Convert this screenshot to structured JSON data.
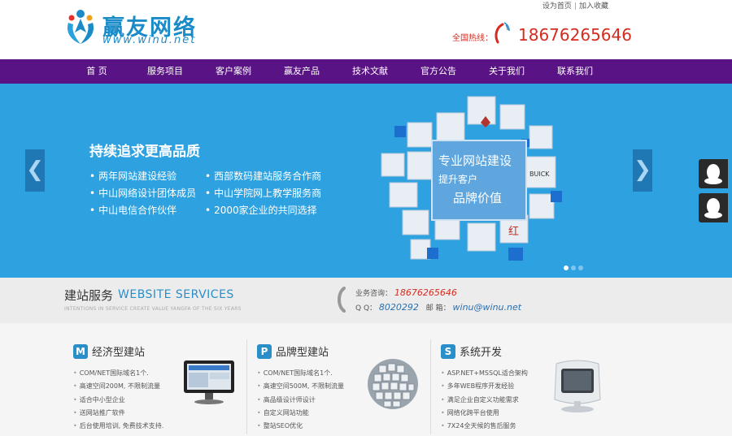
{
  "header": {
    "logo_title": "赢友网络",
    "logo_url": "www.winu.net",
    "top_links": [
      "设为首页",
      "加入收藏"
    ],
    "top_sep": "|",
    "hotline_label": "全国热线：",
    "hotline_number": "18676265646"
  },
  "nav": {
    "items": [
      "首  页",
      "服务项目",
      "客户案例",
      "赢友产品",
      "技术文献",
      "官方公告",
      "关于我们",
      "联系我们"
    ]
  },
  "banner": {
    "title": "持续追求更高品质",
    "bullets": [
      "两年网站建设经验",
      "西部数码建站服务合作商",
      "中山网络设计团体成员",
      "中山学院网上教学服务商",
      "中山电信合作伙伴",
      "2000家企业的共同选择"
    ],
    "prev": "❮",
    "next": "❯",
    "art_line1": "专业网站建设",
    "art_line2": "提升客户",
    "art_line3": "品牌价值",
    "art_brand": "BUICK"
  },
  "services": {
    "title_cn": "建站服务",
    "title_en": "WEBSITE SERVICES",
    "tagline": "INTENTIONS IN SERVICE CREATE VALUE YANGFA OF THE SIX YEARS",
    "consult_label": "业务咨询：",
    "consult_value": "18676265646",
    "qq_label": "Q      Q：",
    "qq_value": "8020292",
    "email_label": "邮      箱：",
    "email_value": "winu@winu.net"
  },
  "columns": [
    {
      "badge": "M",
      "title": "经济型建站",
      "items": [
        "COM/NET国际域名1个.",
        "高速空间200M, 不限制流量",
        "适合中小型企业",
        "送网站推广软件",
        "后台使用培训, 免费技术支持."
      ]
    },
    {
      "badge": "P",
      "title": "品牌型建站",
      "items": [
        "COM/NET国际域名1个.",
        "高速空间500M, 不限制流量",
        "高品级设计师设计",
        "自定义网站功能",
        "整站SEO优化"
      ]
    },
    {
      "badge": "S",
      "title": "系统开发",
      "items": [
        "ASP.NET+MSSQL适合架构",
        "多年WEB程序开发经验",
        "满足企业自定义功能需求",
        "网络化跨平台使用",
        "7X24全天候的售后服务"
      ]
    }
  ],
  "colors": {
    "nav_bg": "#5a1384",
    "banner_bg": "#2ea2e0",
    "accent_blue": "#2a8fc9",
    "hotline_red": "#d62b1f"
  }
}
